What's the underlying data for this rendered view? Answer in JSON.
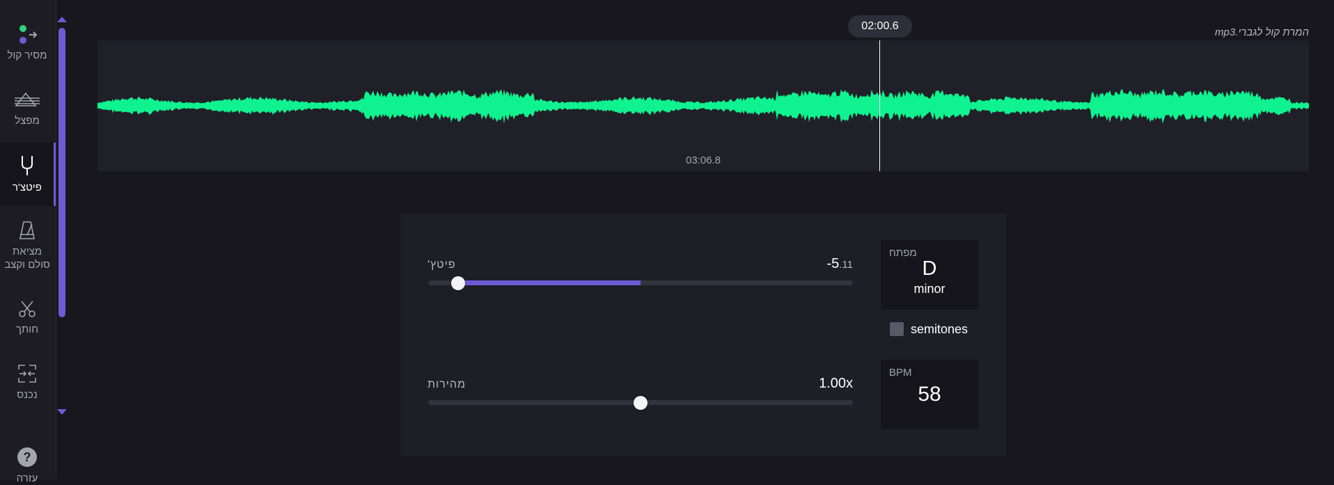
{
  "sidebar": {
    "items": [
      {
        "label": "מסיר קול",
        "icon": "vocal-remover-icon"
      },
      {
        "label": "מפצל",
        "icon": "splitter-icon"
      },
      {
        "label": "פיטצ'ר",
        "icon": "tuning-fork-icon",
        "active": true
      },
      {
        "label": "מציאת סולם וקצב",
        "icon": "metronome-icon"
      },
      {
        "label": "חותך",
        "icon": "scissors-icon"
      },
      {
        "label": "נכנס",
        "icon": "joiner-icon"
      },
      {
        "label": "עזרה",
        "icon": "help-icon"
      }
    ]
  },
  "player": {
    "filename": "המרת קול לגברי.mp3",
    "current_time": "02:00.6",
    "duration": "03:06.8",
    "progress": 0.645,
    "wave_color": "#0ff28f"
  },
  "controls": {
    "pitch": {
      "label": "פיטץ'",
      "value": "-5",
      "value_sub": ".11",
      "position": 0.07
    },
    "speed": {
      "label": "מהירות",
      "value": "1.00x",
      "position": 0.5
    },
    "key": {
      "label": "מפתח",
      "note": "D",
      "mode": "minor"
    },
    "semitones": {
      "label": "semitones",
      "checked": false
    },
    "bpm": {
      "label": "BPM",
      "value": "58"
    },
    "accent_color": "#6e5bd3"
  }
}
